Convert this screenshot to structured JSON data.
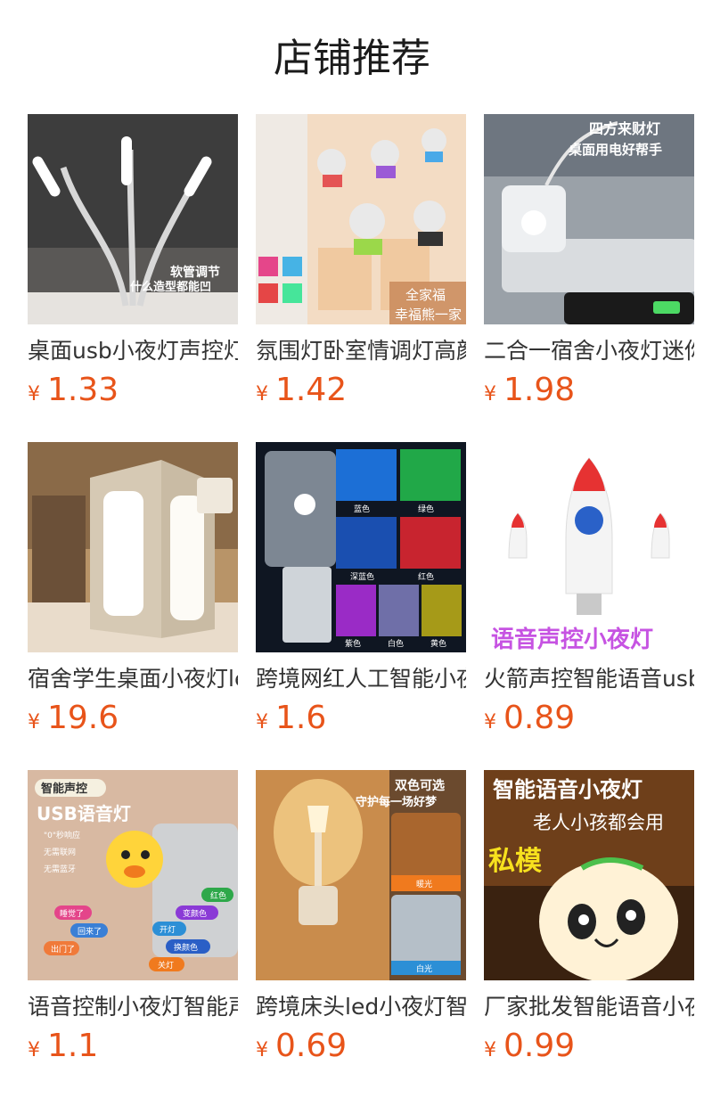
{
  "section_title": "店铺推荐",
  "currency_symbol": "¥",
  "products": [
    {
      "name": "桌面usb小夜灯声控灯",
      "price": "1.33",
      "image_text": [
        "软管调节",
        "什么造型都能凹"
      ]
    },
    {
      "name": "氛围灯卧室情调灯高颜值",
      "price": "1.42",
      "image_text": [
        "全家福",
        "幸福熊一家"
      ]
    },
    {
      "name": "二合一宿舍小夜灯迷你",
      "price": "1.98",
      "image_text": [
        "四方来财灯",
        "桌面用电好帮手"
      ]
    },
    {
      "name": "宿舍学生桌面小夜灯led",
      "price": "19.6",
      "image_text": []
    },
    {
      "name": "跨境网红人工智能小夜灯",
      "price": "1.6",
      "image_text": [
        "蓝色",
        "绿色",
        "深蓝色",
        "红色",
        "紫色",
        "白色",
        "黄色"
      ]
    },
    {
      "name": "火箭声控智能语音usb",
      "price": "0.89",
      "image_text": [
        "语音声控小夜灯"
      ]
    },
    {
      "name": "语音控制小夜灯智能声控",
      "price": "1.1",
      "image_text": [
        "智能声控",
        "USB语音灯",
        "\"0\"秒响应",
        "无需联网",
        "无需蓝牙",
        "红色",
        "睡觉了",
        "变颜色",
        "回来了",
        "开灯",
        "出门了",
        "换颜色",
        "关灯"
      ]
    },
    {
      "name": "跨境床头led小夜灯智能",
      "price": "0.69",
      "image_text": [
        "双色可选",
        "守护每一场好梦",
        "暖光",
        "白光"
      ]
    },
    {
      "name": "厂家批发智能语音小夜灯",
      "price": "0.99",
      "image_text": [
        "智能语音小夜灯",
        "老人小孩都会用",
        "私模"
      ]
    }
  ],
  "colors": {
    "price": "#e8541a",
    "title": "#1b1b1b",
    "name": "#333333"
  }
}
